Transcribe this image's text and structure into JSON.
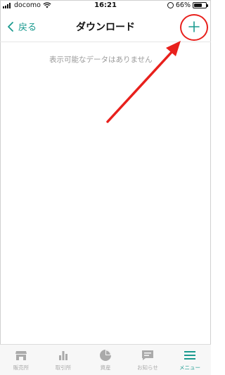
{
  "status_bar": {
    "carrier": "docomo",
    "time": "16:21",
    "battery": "66%",
    "battery_level": 0.66
  },
  "nav": {
    "back_label": "戻る",
    "title": "ダウンロード",
    "add_icon": "plus-icon"
  },
  "content": {
    "empty_message": "表示可能なデータはありません"
  },
  "tabs": [
    {
      "label": "販売所",
      "icon": "store-icon",
      "active": false
    },
    {
      "label": "取引所",
      "icon": "bar-chart-icon",
      "active": false
    },
    {
      "label": "資産",
      "icon": "pie-chart-icon",
      "active": false
    },
    {
      "label": "お知らせ",
      "icon": "message-icon",
      "active": false
    },
    {
      "label": "メニュー",
      "icon": "menu-icon",
      "active": true
    }
  ],
  "colors": {
    "accent": "#1a9a8f",
    "annotation": "#e8201c",
    "inactive_tab": "#aaaaaa"
  }
}
